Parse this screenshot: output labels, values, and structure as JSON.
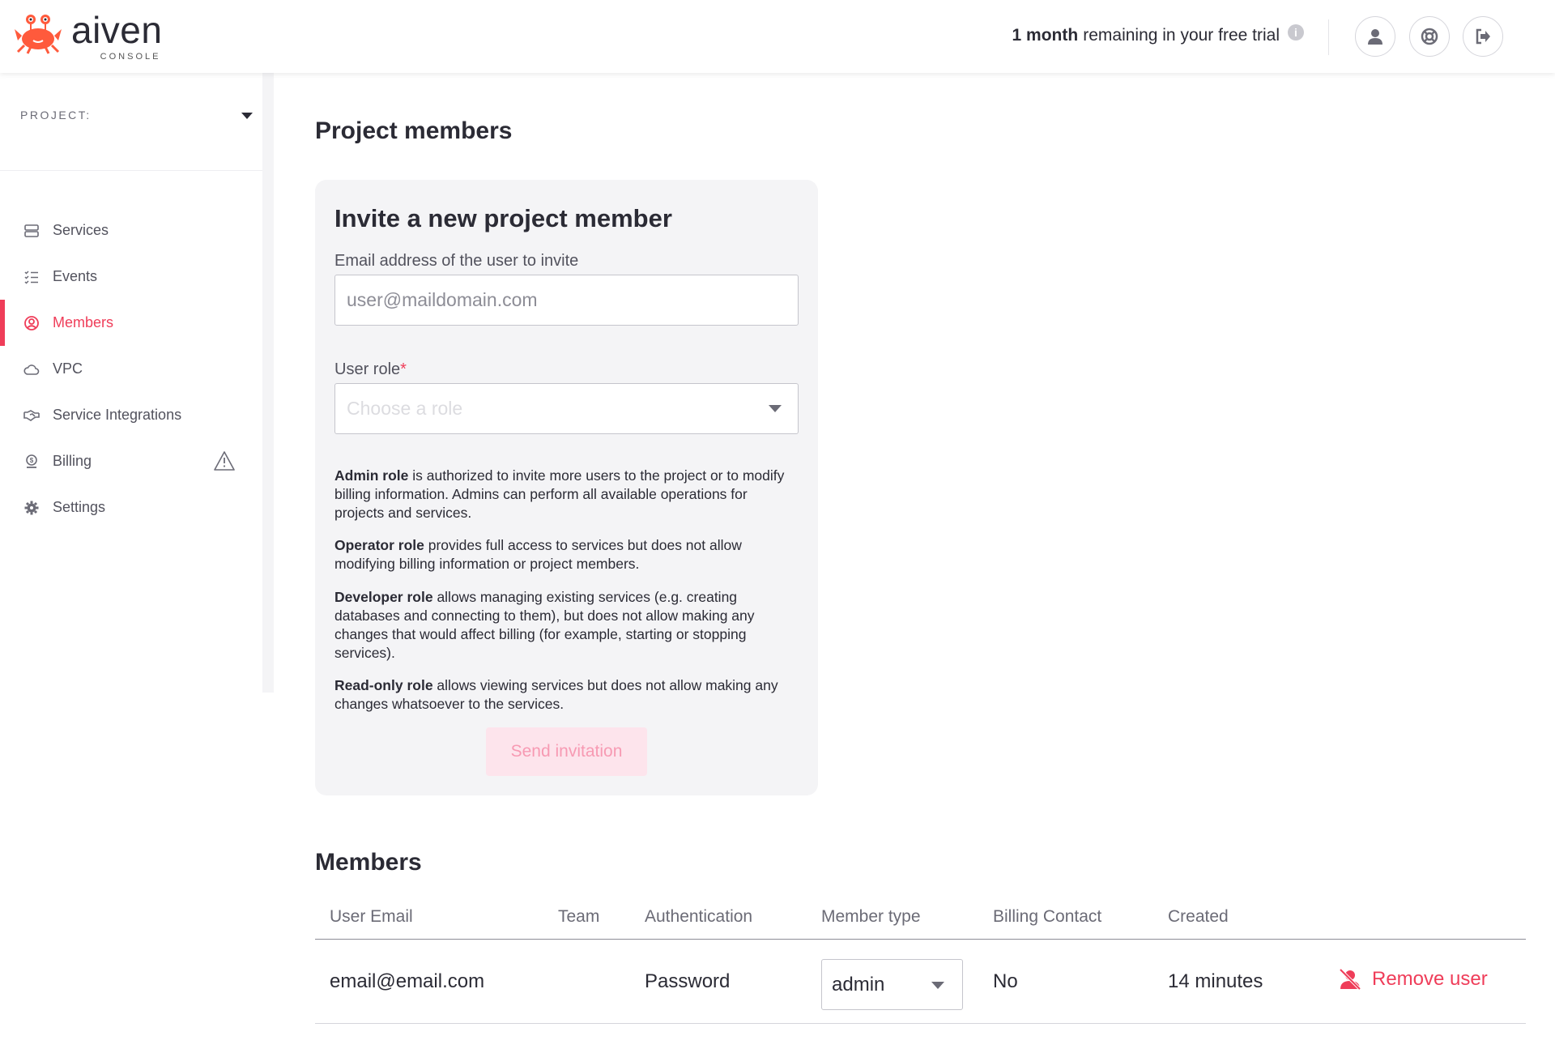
{
  "header": {
    "logo_text": "aiven",
    "logo_sub": "CONSOLE",
    "trial_bold": "1 month",
    "trial_rest": "remaining in your free trial",
    "icons": [
      "user-icon",
      "lifebuoy-icon",
      "logout-icon"
    ]
  },
  "sidebar": {
    "project_label": "PROJECT:",
    "items": [
      {
        "label": "Services",
        "icon": "server-icon"
      },
      {
        "label": "Events",
        "icon": "list-icon"
      },
      {
        "label": "Members",
        "icon": "user-circle-icon",
        "active": true
      },
      {
        "label": "VPC",
        "icon": "cloud-icon"
      },
      {
        "label": "Service Integrations",
        "icon": "handshake-icon"
      },
      {
        "label": "Billing",
        "icon": "dollar-badge-icon",
        "warning": true
      },
      {
        "label": "Settings",
        "icon": "gear-icon"
      }
    ]
  },
  "main": {
    "title": "Project members",
    "invite": {
      "title": "Invite a new project member",
      "email_label": "Email address of the user to invite",
      "email_placeholder": "user@maildomain.com",
      "role_label": "User role",
      "role_required": "*",
      "role_placeholder": "Choose a role",
      "roles": [
        {
          "name": "Admin role",
          "text": " is authorized to invite more users to the project or to modify billing information. Admins can perform all available operations for projects and services."
        },
        {
          "name": "Operator role",
          "text": " provides full access to services but does not allow modifying billing information or project members."
        },
        {
          "name": "Developer role",
          "text": " allows managing existing services (e.g. creating databases and connecting to them), but does not allow making any changes that would affect billing (for example, starting or stopping services)."
        },
        {
          "name": "Read-only role",
          "text": " allows viewing services but does not allow making any changes whatsoever to the services."
        }
      ],
      "send_label": "Send invitation"
    },
    "members": {
      "title": "Members",
      "columns": [
        "User Email",
        "Team",
        "Authentication",
        "Member type",
        "Billing Contact",
        "Created"
      ],
      "rows": [
        {
          "email": "email@email.com",
          "team": "",
          "auth": "Password",
          "type": "admin",
          "billing": "No",
          "created": "14 minutes",
          "action": "Remove user"
        }
      ]
    }
  },
  "colors": {
    "accent": "#ef3d59",
    "accent_light": "#fde4ec",
    "text": "#2b2b35",
    "card_bg": "#f4f4f6"
  }
}
